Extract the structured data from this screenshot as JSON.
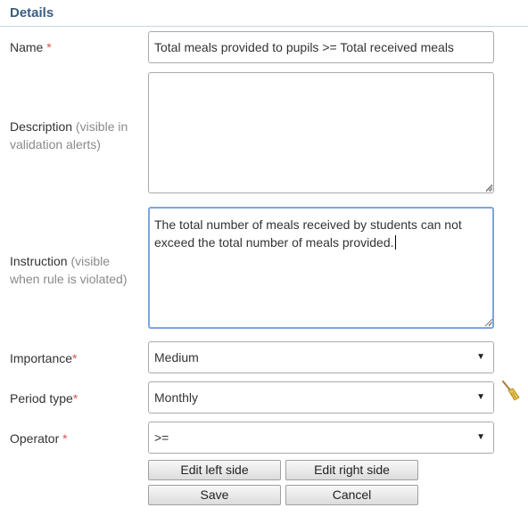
{
  "section": {
    "title": "Details"
  },
  "name": {
    "label": "Name",
    "required_mark": "*",
    "value": "Total meals provided to pupils >= Total received meals"
  },
  "description": {
    "label": "Description",
    "hint_line1": "(visible in",
    "hint_line2": "validation alerts)",
    "value": ""
  },
  "instruction": {
    "label": "Instruction",
    "hint_line1": "(visible",
    "hint_line2": "when rule is violated)",
    "value": "The total number of meals received by students can not exceed the total number of meals provided."
  },
  "importance": {
    "label": "Importance",
    "required_mark": "*",
    "selected": "Medium"
  },
  "period_type": {
    "label": "Period type",
    "required_mark": "*",
    "selected": "Monthly"
  },
  "operator": {
    "label": "Operator",
    "required_mark": "*",
    "selected": ">="
  },
  "buttons": {
    "edit_left": "Edit left side",
    "edit_right": "Edit right side",
    "save": "Save",
    "cancel": "Cancel"
  },
  "colors": {
    "heading": "#3d5c80",
    "required": "#d9534f",
    "focus_border": "#7aa6e0"
  },
  "icons": {
    "clear": "broom-icon",
    "dropdown": "caret-down-icon"
  }
}
